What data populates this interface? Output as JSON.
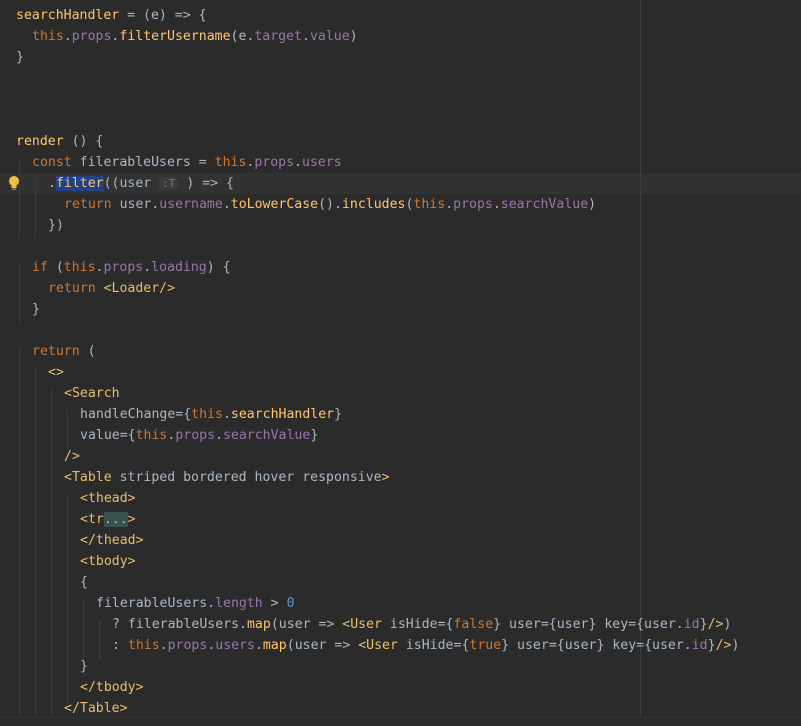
{
  "code": {
    "l1": [
      "searchHandler",
      " = (e) => {"
    ],
    "l2": [
      "this",
      ".",
      "props",
      ".",
      "filterUsername",
      "(e.",
      "target",
      ".",
      "value",
      ")"
    ],
    "l3": "}",
    "l4": [
      "render",
      " () {"
    ],
    "l5": [
      "const",
      " filerableUsers = ",
      "this",
      ".",
      "props",
      ".",
      "users"
    ],
    "l6": [
      ".",
      "filter",
      "((user ",
      ":T",
      " ) => {"
    ],
    "l7": [
      "return",
      " user.",
      "username",
      ".",
      "toLowerCase",
      "().",
      "includes",
      "(",
      "this",
      ".",
      "props",
      ".",
      "searchValue",
      ")"
    ],
    "l8": "})",
    "l9": [
      "if",
      " (",
      "this",
      ".",
      "props",
      ".",
      "loading",
      ") {"
    ],
    "l10": [
      "return",
      " ",
      "<Loader/>"
    ],
    "l11": "}",
    "l12": [
      "return",
      " ("
    ],
    "l13": "<>",
    "l14": "<Search",
    "l15": [
      "handleChange",
      "={",
      "this",
      ".",
      "searchHandler",
      "}"
    ],
    "l16": [
      "value",
      "={",
      "this",
      ".",
      "props",
      ".",
      "searchValue",
      "}"
    ],
    "l17": "/>",
    "l18": [
      "<Table",
      " striped bordered hover responsive",
      ">"
    ],
    "l19": "<thead>",
    "l20": [
      "<tr",
      "...",
      ">"
    ],
    "l21": "</thead>",
    "l22": "<tbody>",
    "l23": "{",
    "l24": [
      "filerableUsers.",
      "length",
      " > ",
      "0"
    ],
    "l25": [
      "? filerableUsers.",
      "map",
      "(user => ",
      "<User",
      " isHide",
      "={",
      "false",
      "}",
      " user",
      "={user}",
      " key",
      "={user.",
      "id",
      "}",
      "/>",
      ")"
    ],
    "l26": [
      ": ",
      "this",
      ".",
      "props",
      ".",
      "users",
      ".",
      "map",
      "(user => ",
      "<User",
      " isHide",
      "={",
      "true",
      "}",
      " user",
      "={user}",
      " key",
      "={user.",
      "id",
      "}",
      "/>",
      ")"
    ],
    "l27": "}",
    "l28": "</tbody>",
    "l29": "</Table>"
  },
  "colors": {
    "background": "#2b2b2b",
    "keyword": "#cc7832",
    "property": "#9876aa",
    "function": "#ffc66d",
    "tag": "#e8bf6a",
    "number": "#6897bb",
    "text": "#a9b7c6"
  },
  "icons": {
    "gutter_hint": "lightbulb-icon"
  }
}
